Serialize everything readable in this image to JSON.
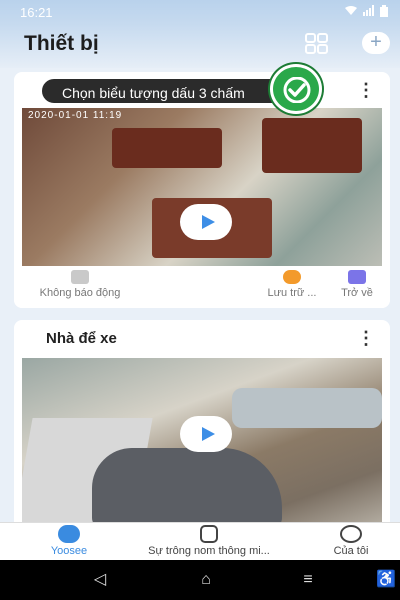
{
  "status_bar": {
    "time": "16:21",
    "icons": [
      "wifi-icon",
      "signal-icon",
      "signal-icon",
      "battery-icon"
    ]
  },
  "header": {
    "title": "Thiết bị"
  },
  "cards": [
    {
      "name": "",
      "timestamp": "2020-01-01 11:19",
      "actions": {
        "alarm_label": "Không báo động",
        "storage_label": "Lưu trữ ...",
        "playback_label": "Trở về"
      }
    },
    {
      "name": "Nhà để xe"
    }
  ],
  "tooltip": {
    "text": "Chọn biểu tượng dấu 3 chấm"
  },
  "bottom_nav": {
    "home": "Yoosee",
    "alerts": "Sự trông nom thông mi...",
    "me": "Của tôi"
  },
  "colors": {
    "accent": "#3a8be0",
    "check": "#2aa84a",
    "storage_icon": "#f39a2b",
    "playback_icon": "#7b74e8"
  }
}
